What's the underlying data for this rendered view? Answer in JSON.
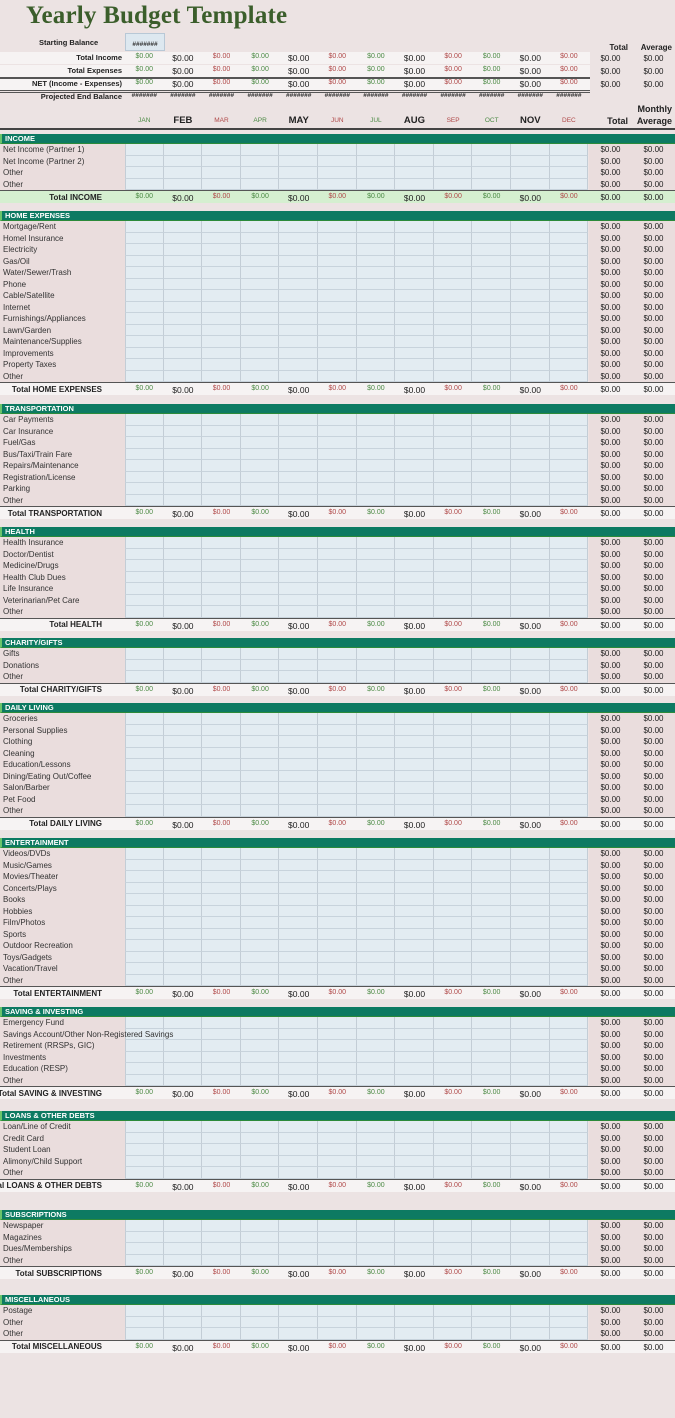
{
  "title": "Yearly Budget Template",
  "colors": {
    "accent_header": "#0d7a62",
    "green_value": "#4b8a44",
    "red_value": "#b04848",
    "title_green": "#3b5e2b"
  },
  "summary": {
    "starting_balance_label": "Starting Balance",
    "starting_balance_value": "#######",
    "total_header": "Total",
    "average_header": "Average",
    "rows": [
      {
        "label": "Total Income",
        "values": [
          "$0.00",
          "$0.00",
          "$0.00",
          "$0.00",
          "$0.00",
          "$0.00",
          "$0.00",
          "$0.00",
          "$0.00",
          "$0.00",
          "$0.00",
          "$0.00"
        ],
        "total": "$0.00",
        "average": "$0.00"
      },
      {
        "label": "Total Expenses",
        "values": [
          "$0.00",
          "$0.00",
          "$0.00",
          "$0.00",
          "$0.00",
          "$0.00",
          "$0.00",
          "$0.00",
          "$0.00",
          "$0.00",
          "$0.00",
          "$0.00"
        ],
        "total": "$0.00",
        "average": "$0.00"
      },
      {
        "label": "NET (Income - Expenses)",
        "values": [
          "$0.00",
          "$0.00",
          "$0.00",
          "$0.00",
          "$0.00",
          "$0.00",
          "$0.00",
          "$0.00",
          "$0.00",
          "$0.00",
          "$0.00",
          "$0.00"
        ],
        "total": "$0.00",
        "average": "$0.00"
      },
      {
        "label": "Projected End Balance",
        "values": [
          "#######",
          "#######",
          "#######",
          "#######",
          "#######",
          "#######",
          "#######",
          "#######",
          "#######",
          "#######",
          "#######",
          "#######"
        ]
      }
    ]
  },
  "months": [
    "JAN",
    "FEB",
    "MAR",
    "APR",
    "MAY",
    "JUN",
    "JUL",
    "AUG",
    "SEP",
    "OCT",
    "NOV",
    "DEC"
  ],
  "column_headers": {
    "total": "Total",
    "monthly": "Monthly",
    "average": "Average"
  },
  "zero": "$0.00",
  "sections": [
    {
      "name": "INCOME",
      "total_label": "Total INCOME",
      "items": [
        "Net Income  (Partner 1)",
        "Net Income (Partner 2)",
        "Other",
        "Other"
      ]
    },
    {
      "name": "HOME EXPENSES",
      "total_label": "Total HOME EXPENSES",
      "items": [
        "Mortgage/Rent",
        "Homel Insurance",
        "Electricity",
        "Gas/Oil",
        "Water/Sewer/Trash",
        "Phone",
        "Cable/Satellite",
        "Internet",
        "Furnishings/Appliances",
        "Lawn/Garden",
        "Maintenance/Supplies",
        "Improvements",
        "Property Taxes",
        "Other"
      ]
    },
    {
      "name": "TRANSPORTATION",
      "total_label": "Total TRANSPORTATION",
      "items": [
        "Car Payments",
        "Car Insurance",
        "Fuel/Gas",
        "Bus/Taxi/Train Fare",
        "Repairs/Maintenance",
        "Registration/License",
        "Parking",
        "Other"
      ]
    },
    {
      "name": "HEALTH",
      "total_label": "Total HEALTH",
      "items": [
        "Health Insurance",
        "Doctor/Dentist",
        "Medicine/Drugs",
        "Health Club Dues",
        "Life Insurance",
        "Veterinarian/Pet Care",
        "Other"
      ]
    },
    {
      "name": "CHARITY/GIFTS",
      "total_label": "Total CHARITY/GIFTS",
      "items": [
        "Gifts",
        "Donations",
        "Other"
      ]
    },
    {
      "name": "DAILY LIVING",
      "total_label": "Total DAILY LIVING",
      "items": [
        "Groceries",
        "Personal Supplies",
        "Clothing",
        "Cleaning",
        "Education/Lessons",
        "Dining/Eating Out/Coffee",
        "Salon/Barber",
        "Pet Food",
        "Other"
      ]
    },
    {
      "name": "ENTERTAINMENT",
      "total_label": "Total ENTERTAINMENT",
      "items": [
        "Videos/DVDs",
        "Music/Games",
        "Movies/Theater",
        "Concerts/Plays",
        "Books",
        "Hobbies",
        "Film/Photos",
        "Sports",
        "Outdoor Recreation",
        "Toys/Gadgets",
        "Vacation/Travel",
        "Other"
      ]
    },
    {
      "name": "SAVING & INVESTING",
      "total_label": "Total SAVING & INVESTING",
      "items": [
        "Emergency Fund",
        "Savings Account/Other Non-Registered Savings",
        "Retirement (RRSPs, GIC)",
        "Investments",
        "Education (RESP)",
        "Other"
      ]
    },
    {
      "name": "LOANS & OTHER DEBTS",
      "total_label": "Total LOANS & OTHER DEBTS",
      "items": [
        "Loan/Line of Credit",
        "Credit Card",
        "Student Loan",
        "Alimony/Child Support",
        "Other"
      ]
    },
    {
      "name": "SUBSCRIPTIONS",
      "total_label": "Total SUBSCRIPTIONS",
      "items": [
        "Newspaper",
        "Magazines",
        "Dues/Memberships",
        "Other"
      ]
    },
    {
      "name": "MISCELLANEOUS",
      "total_label": "Total MISCELLANEOUS",
      "items": [
        "Postage",
        "Other",
        "Other"
      ]
    }
  ]
}
